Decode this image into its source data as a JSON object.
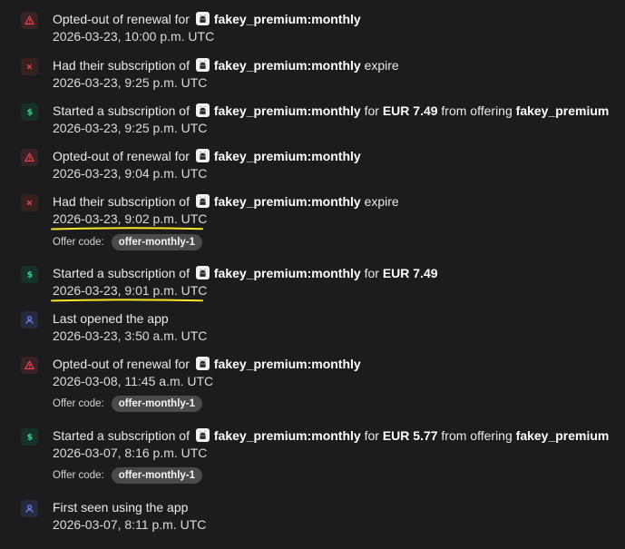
{
  "colors": {
    "background": "#1c1c1e",
    "warn": "#e5484d",
    "expire": "#e5484d",
    "money": "#3dd68c",
    "user": "#7b8dff",
    "highlight": "#f5e62a"
  },
  "events": [
    {
      "icon": "warning-icon",
      "prefix": "Opted-out of renewal for",
      "product": "fakey_premium:monthly",
      "suffix": "",
      "timestamp": "2026-03-23, 10:00 p.m. UTC"
    },
    {
      "icon": "expire-x-icon",
      "prefix": "Had their subscription of",
      "product": "fakey_premium:monthly",
      "suffix": "expire",
      "timestamp": "2026-03-23, 9:25 p.m. UTC"
    },
    {
      "icon": "dollar-icon",
      "prefix": "Started a subscription of",
      "product": "fakey_premium:monthly",
      "for_text": "for",
      "price": "EUR 7.49",
      "from_text": "from offering",
      "offering": "fakey_premium",
      "timestamp": "2026-03-23, 9:25 p.m. UTC"
    },
    {
      "icon": "warning-icon",
      "prefix": "Opted-out of renewal for",
      "product": "fakey_premium:monthly",
      "suffix": "",
      "timestamp": "2026-03-23, 9:04 p.m. UTC"
    },
    {
      "icon": "expire-x-icon",
      "prefix": "Had their subscription of",
      "product": "fakey_premium:monthly",
      "suffix": "expire",
      "timestamp": "2026-03-23, 9:02 p.m. UTC",
      "offer_label": "Offer code:",
      "offer_code": "offer-monthly-1"
    },
    {
      "icon": "dollar-icon",
      "prefix": "Started a subscription of",
      "product": "fakey_premium:monthly",
      "for_text": "for",
      "price": "EUR 7.49",
      "timestamp": "2026-03-23, 9:01 p.m. UTC"
    },
    {
      "icon": "user-icon",
      "prefix": "Last opened the app",
      "timestamp": "2026-03-23, 3:50 a.m. UTC"
    },
    {
      "icon": "warning-icon",
      "prefix": "Opted-out of renewal for",
      "product": "fakey_premium:monthly",
      "suffix": "",
      "timestamp": "2026-03-08, 11:45 a.m. UTC",
      "offer_label": "Offer code:",
      "offer_code": "offer-monthly-1"
    },
    {
      "icon": "dollar-icon",
      "prefix": "Started a subscription of",
      "product": "fakey_premium:monthly",
      "for_text": "for",
      "price": "EUR 5.77",
      "from_text": "from offering",
      "offering": "fakey_premium",
      "timestamp": "2026-03-07, 8:16 p.m. UTC",
      "offer_label": "Offer code:",
      "offer_code": "offer-monthly-1"
    },
    {
      "icon": "user-icon",
      "prefix": "First seen using the app",
      "timestamp": "2026-03-07, 8:11 p.m. UTC"
    }
  ]
}
